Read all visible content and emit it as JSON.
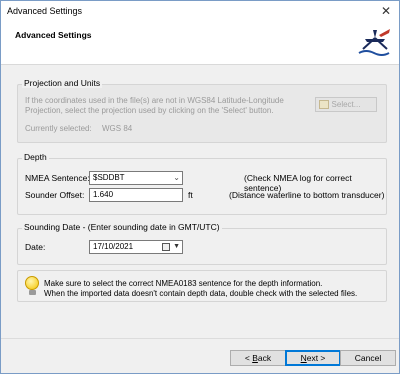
{
  "window": {
    "title": "Advanced Settings",
    "close_glyph": "✕"
  },
  "header": {
    "title": "Advanced Settings",
    "logo_icon": "survey-boat-logo-icon"
  },
  "projection": {
    "legend": "Projection and Units",
    "description": "If the coordinates used in the file(s) are not in WGS84 Latitude-Longitude Projection, select the projection used by clicking on the 'Select' button.",
    "current_label": "Currently selected:",
    "current_value": "WGS 84",
    "select_label": "Select..."
  },
  "depth": {
    "legend": "Depth",
    "nmea_label": "NMEA Sentence:",
    "nmea_value": "$SDDBT",
    "nmea_hint": "(Check NMEA log for correct sentence)",
    "offset_label": "Sounder Offset:",
    "offset_value": "1.640",
    "offset_unit": "ft",
    "offset_hint": "(Distance waterline to bottom transducer)"
  },
  "sounding": {
    "legend": "Sounding Date - (Enter sounding date in GMT/UTC)",
    "date_label": "Date:",
    "date_value": "17/10/2021"
  },
  "info": {
    "line1": "Make sure to select the correct NMEA0183 sentence for the depth information.",
    "line2": "When the imported data doesn't contain depth data, double check with the selected files."
  },
  "buttons": {
    "back_prefix": "< ",
    "back_key": "B",
    "back_rest": "ack",
    "next_key": "N",
    "next_rest": "ext >",
    "cancel": "Cancel"
  }
}
